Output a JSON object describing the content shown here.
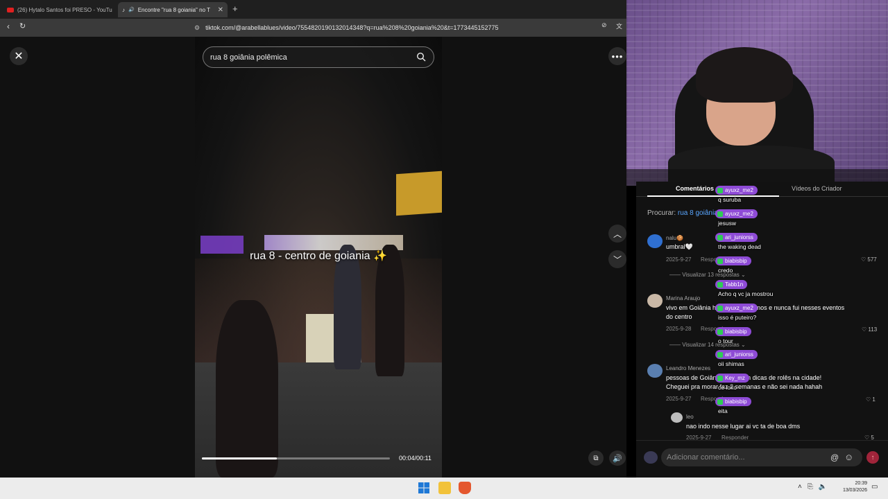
{
  "browser": {
    "tabs": [
      {
        "label": "(26) Hytalo Santos foi PRESO - YouTu",
        "active": false
      },
      {
        "label": "Encontre \"rua 8 goiania\" no T",
        "active": true
      }
    ],
    "new_tab": "+",
    "url": "tiktok.com/@arabellablues/video/7554820190132014348?q=rua%208%20goiania%20&t=1773445152775"
  },
  "tiktok": {
    "close": "✕",
    "more": "•••",
    "search_value": "rua 8 goiânia polêmica",
    "caption": "rua 8 - centro de goiania ✨",
    "video_progress": 0.4,
    "time": "00:04/00:11",
    "tabs": {
      "comments": "Comentários",
      "creator_videos": "Vídeos do Criador"
    },
    "procurar_label": "Procurar:",
    "procurar_query": "rua 8 goiânia",
    "comments": [
      {
        "name": "nalu🍪",
        "text": "umbral🤍",
        "date": "2025-9-27",
        "reply": "Responder",
        "likes": "577",
        "replies": "Visualizar 13 respostas"
      },
      {
        "name": "Marina Araujo",
        "text1": "vivo em Goiânia há mais de 10 anos e nunca fui nesses eventos",
        "text2": "do centro",
        "date": "2025-9-28",
        "reply": "Responder",
        "likes": "113",
        "replies": "Visualizar 14 respostas"
      },
      {
        "name": "Leandro Menezes",
        "text1": "pessoas de Goiânia, me deem dicas de rolês na cidade!",
        "text2": "Cheguei pra morar faz 2 semanas e não sei nada hahah",
        "date": "2025-9-27",
        "reply": "Responder",
        "likes": "1"
      },
      {
        "name": "leo",
        "text": "nao indo nesse lugar ai vc ta de boa dms",
        "date": "2025-9-27",
        "reply": "Responder",
        "likes": "5"
      }
    ],
    "comment_placeholder": "Adicionar comentário...",
    "at": "@",
    "emoji": "☺",
    "send": "↑"
  },
  "chat": [
    {
      "user": "ayuxz_me2",
      "msg": "q suruba"
    },
    {
      "user": "ayuxz_me2",
      "msg": "jesusw"
    },
    {
      "user": "ari_juniorss",
      "msg": "the waking dead"
    },
    {
      "user": "biabisbip",
      "msg": "credo"
    },
    {
      "user": "Tabb1n",
      "msg": "Acho q vc ja mostrou"
    },
    {
      "user": "ayuxz_me2",
      "msg": "isso é puteiro?"
    },
    {
      "user": "biabisbip",
      "msg": "o tour"
    },
    {
      "user": "ari_juniorss",
      "msg": "oii shimas"
    },
    {
      "user": "Key_mz",
      "msg": "ce loko"
    },
    {
      "user": "biabisbip",
      "msg": "eita"
    }
  ],
  "taskbar": {
    "tray": [
      "˄",
      "⎘",
      "🔈"
    ],
    "time": "20:39",
    "date": "13/03/2026"
  },
  "colors": {
    "accent_chat": "#8e4bd6",
    "link": "#59a6ff",
    "send": "#a0243a"
  }
}
